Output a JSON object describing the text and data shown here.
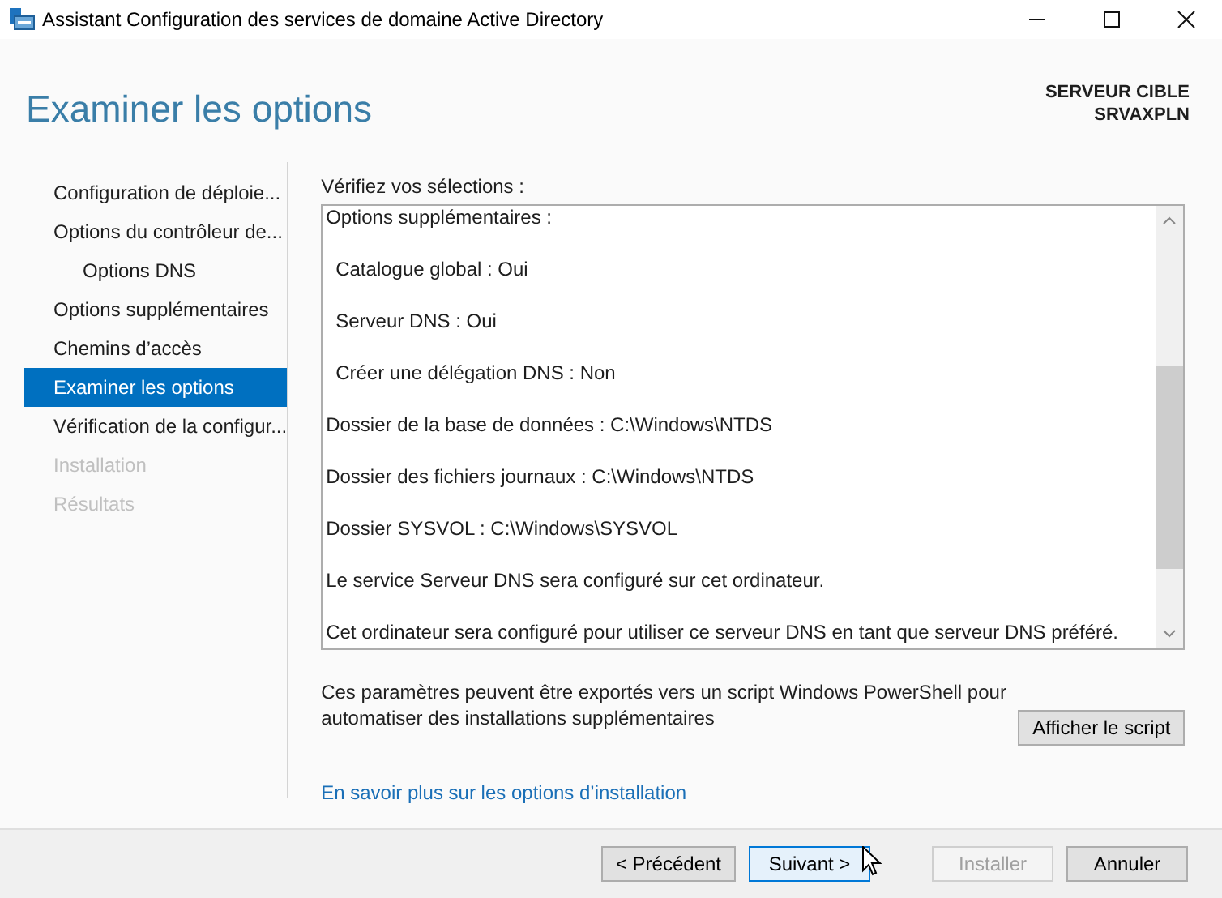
{
  "window": {
    "title": "Assistant Configuration des services de domaine Active Directory"
  },
  "header": {
    "title": "Examiner les options",
    "target_label": "SERVEUR CIBLE",
    "target_name": "SRVAXPLN"
  },
  "sidebar": {
    "items": [
      {
        "label": "Configuration de déploie...",
        "selected": false,
        "disabled": false
      },
      {
        "label": "Options du contrôleur de...",
        "selected": false,
        "disabled": false,
        "children": [
          {
            "label": "Options DNS",
            "selected": false,
            "disabled": false
          }
        ]
      },
      {
        "label": "Options supplémentaires",
        "selected": false,
        "disabled": false
      },
      {
        "label": "Chemins d’accès",
        "selected": false,
        "disabled": false
      },
      {
        "label": "Examiner les options",
        "selected": true,
        "disabled": false
      },
      {
        "label": "Vérification de la configur...",
        "selected": false,
        "disabled": false
      },
      {
        "label": "Installation",
        "selected": false,
        "disabled": true
      },
      {
        "label": "Résultats",
        "selected": false,
        "disabled": true
      }
    ]
  },
  "review": {
    "label": "Vérifiez vos sélections :",
    "lines": [
      {
        "text": "Options supplémentaires :",
        "indented": false
      },
      {
        "text": "Catalogue global : Oui",
        "indented": true
      },
      {
        "text": "Serveur DNS : Oui",
        "indented": true
      },
      {
        "text": "Créer une délégation DNS : Non",
        "indented": true
      },
      {
        "text": "Dossier de la base de données : C:\\Windows\\NTDS",
        "indented": false
      },
      {
        "text": "Dossier des fichiers journaux : C:\\Windows\\NTDS",
        "indented": false
      },
      {
        "text": "Dossier SYSVOL : C:\\Windows\\SYSVOL",
        "indented": false
      },
      {
        "text": "Le service Serveur DNS sera configuré sur cet ordinateur.",
        "indented": false
      },
      {
        "text": "Cet ordinateur sera configuré pour utiliser ce serveur DNS en tant que serveur DNS préféré.",
        "indented": false
      }
    ]
  },
  "export": {
    "text": "Ces paramètres peuvent être exportés vers un script Windows PowerShell pour automatiser des installations supplémentaires",
    "button": "Afficher le script"
  },
  "link": "En savoir plus sur les options d’installation",
  "buttons": [
    {
      "label": "< Précédent",
      "hovered": false,
      "disabled": false
    },
    {
      "label": "Suivant >",
      "hovered": true,
      "disabled": false
    },
    {
      "label": "Installer",
      "hovered": false,
      "disabled": true
    },
    {
      "label": "Annuler",
      "hovered": false,
      "disabled": false
    }
  ]
}
